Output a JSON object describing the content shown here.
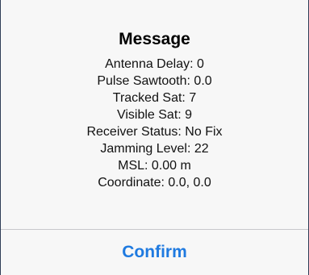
{
  "dialog": {
    "title": "Message",
    "lines": [
      "Antenna Delay: 0",
      "Pulse Sawtooth: 0.0",
      "Tracked Sat: 7",
      "Visible Sat: 9",
      "Receiver Status: No Fix",
      "Jamming Level: 22",
      "MSL: 0.00 m",
      "Coordinate: 0.0, 0.0"
    ],
    "confirm_label": "Confirm"
  },
  "colors": {
    "accent": "#1f7ae0",
    "background": "#f7f7f7",
    "divider": "#c8c8cc"
  }
}
